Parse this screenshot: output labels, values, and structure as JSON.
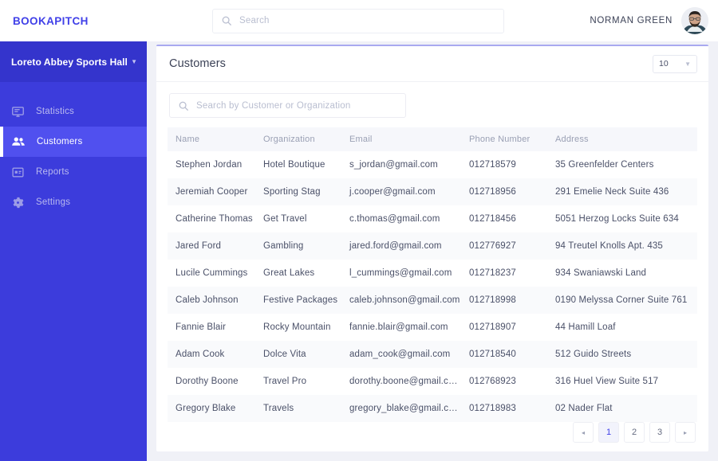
{
  "topbar": {
    "brand": "BOOKAPITCH",
    "search_placeholder": "Search",
    "search_value": "",
    "user_name": "NORMAN GREEN"
  },
  "sidebar": {
    "org_title": "Loreto Abbey Sports Hall",
    "items": [
      {
        "label": "Statistics",
        "icon": "monitor-icon",
        "active": false
      },
      {
        "label": "Customers",
        "icon": "people-icon",
        "active": true
      },
      {
        "label": "Reports",
        "icon": "report-icon",
        "active": false
      },
      {
        "label": "Settings",
        "icon": "gear-icon",
        "active": false
      }
    ]
  },
  "card": {
    "title": "Customers",
    "page_size": "10",
    "table_search_placeholder": "Search by Customer or Organization",
    "table_search_value": "",
    "columns": [
      "Name",
      "Organization",
      "Email",
      "Phone Number",
      "Address"
    ],
    "rows": [
      [
        "Stephen Jordan",
        "Hotel Boutique",
        "s_jordan@gmail.com",
        "012718579",
        "35 Greenfelder Centers"
      ],
      [
        "Jeremiah Cooper",
        "Sporting Stag",
        "j.cooper@gmail.com",
        "012718956",
        "291 Emelie Neck Suite 436"
      ],
      [
        "Catherine Thomas",
        "Get Travel",
        "c.thomas@gmail.com",
        "012718456",
        "5051 Herzog Locks Suite 634"
      ],
      [
        "Jared Ford",
        "Gambling",
        "jared.ford@gmail.com",
        "012776927",
        "94 Treutel Knolls Apt. 435"
      ],
      [
        "Lucile Cummings",
        "Great Lakes",
        "l_cummings@gmail.com",
        "012718237",
        "934 Swaniawski Land"
      ],
      [
        "Caleb Johnson",
        "Festive Packages",
        "caleb.johnson@gmail.com",
        "012718998",
        "0190 Melyssa Corner Suite 761"
      ],
      [
        "Fannie Blair",
        "Rocky Mountain",
        "fannie.blair@gmail.com",
        "012718907",
        "44 Hamill Loaf"
      ],
      [
        "Adam Cook",
        "Dolce Vita",
        "adam_cook@gmail.com",
        "012718540",
        "512 Guido Streets"
      ],
      [
        "Dorothy Boone",
        "Travel Pro",
        "dorothy.boone@gmail.com",
        "012768923",
        "316 Huel View Suite 517"
      ],
      [
        "Gregory Blake",
        "Travels",
        "gregory_blake@gmail.com",
        "012718983",
        "02 Nader Flat"
      ]
    ],
    "pagination": {
      "prev_label": "◂",
      "next_label": "▸",
      "pages": [
        "1",
        "2",
        "3"
      ],
      "active_page": "1"
    }
  },
  "colors": {
    "brand": "#4040e8",
    "sidebar": "#3c3cdc",
    "sidebar_head": "#3434cc",
    "sidebar_active": "#5050ef",
    "page_bg": "#f0f1f7",
    "card_accent": "#a9a9f0",
    "row_alt": "#f9fafc",
    "header_row": "#f6f7fb"
  }
}
